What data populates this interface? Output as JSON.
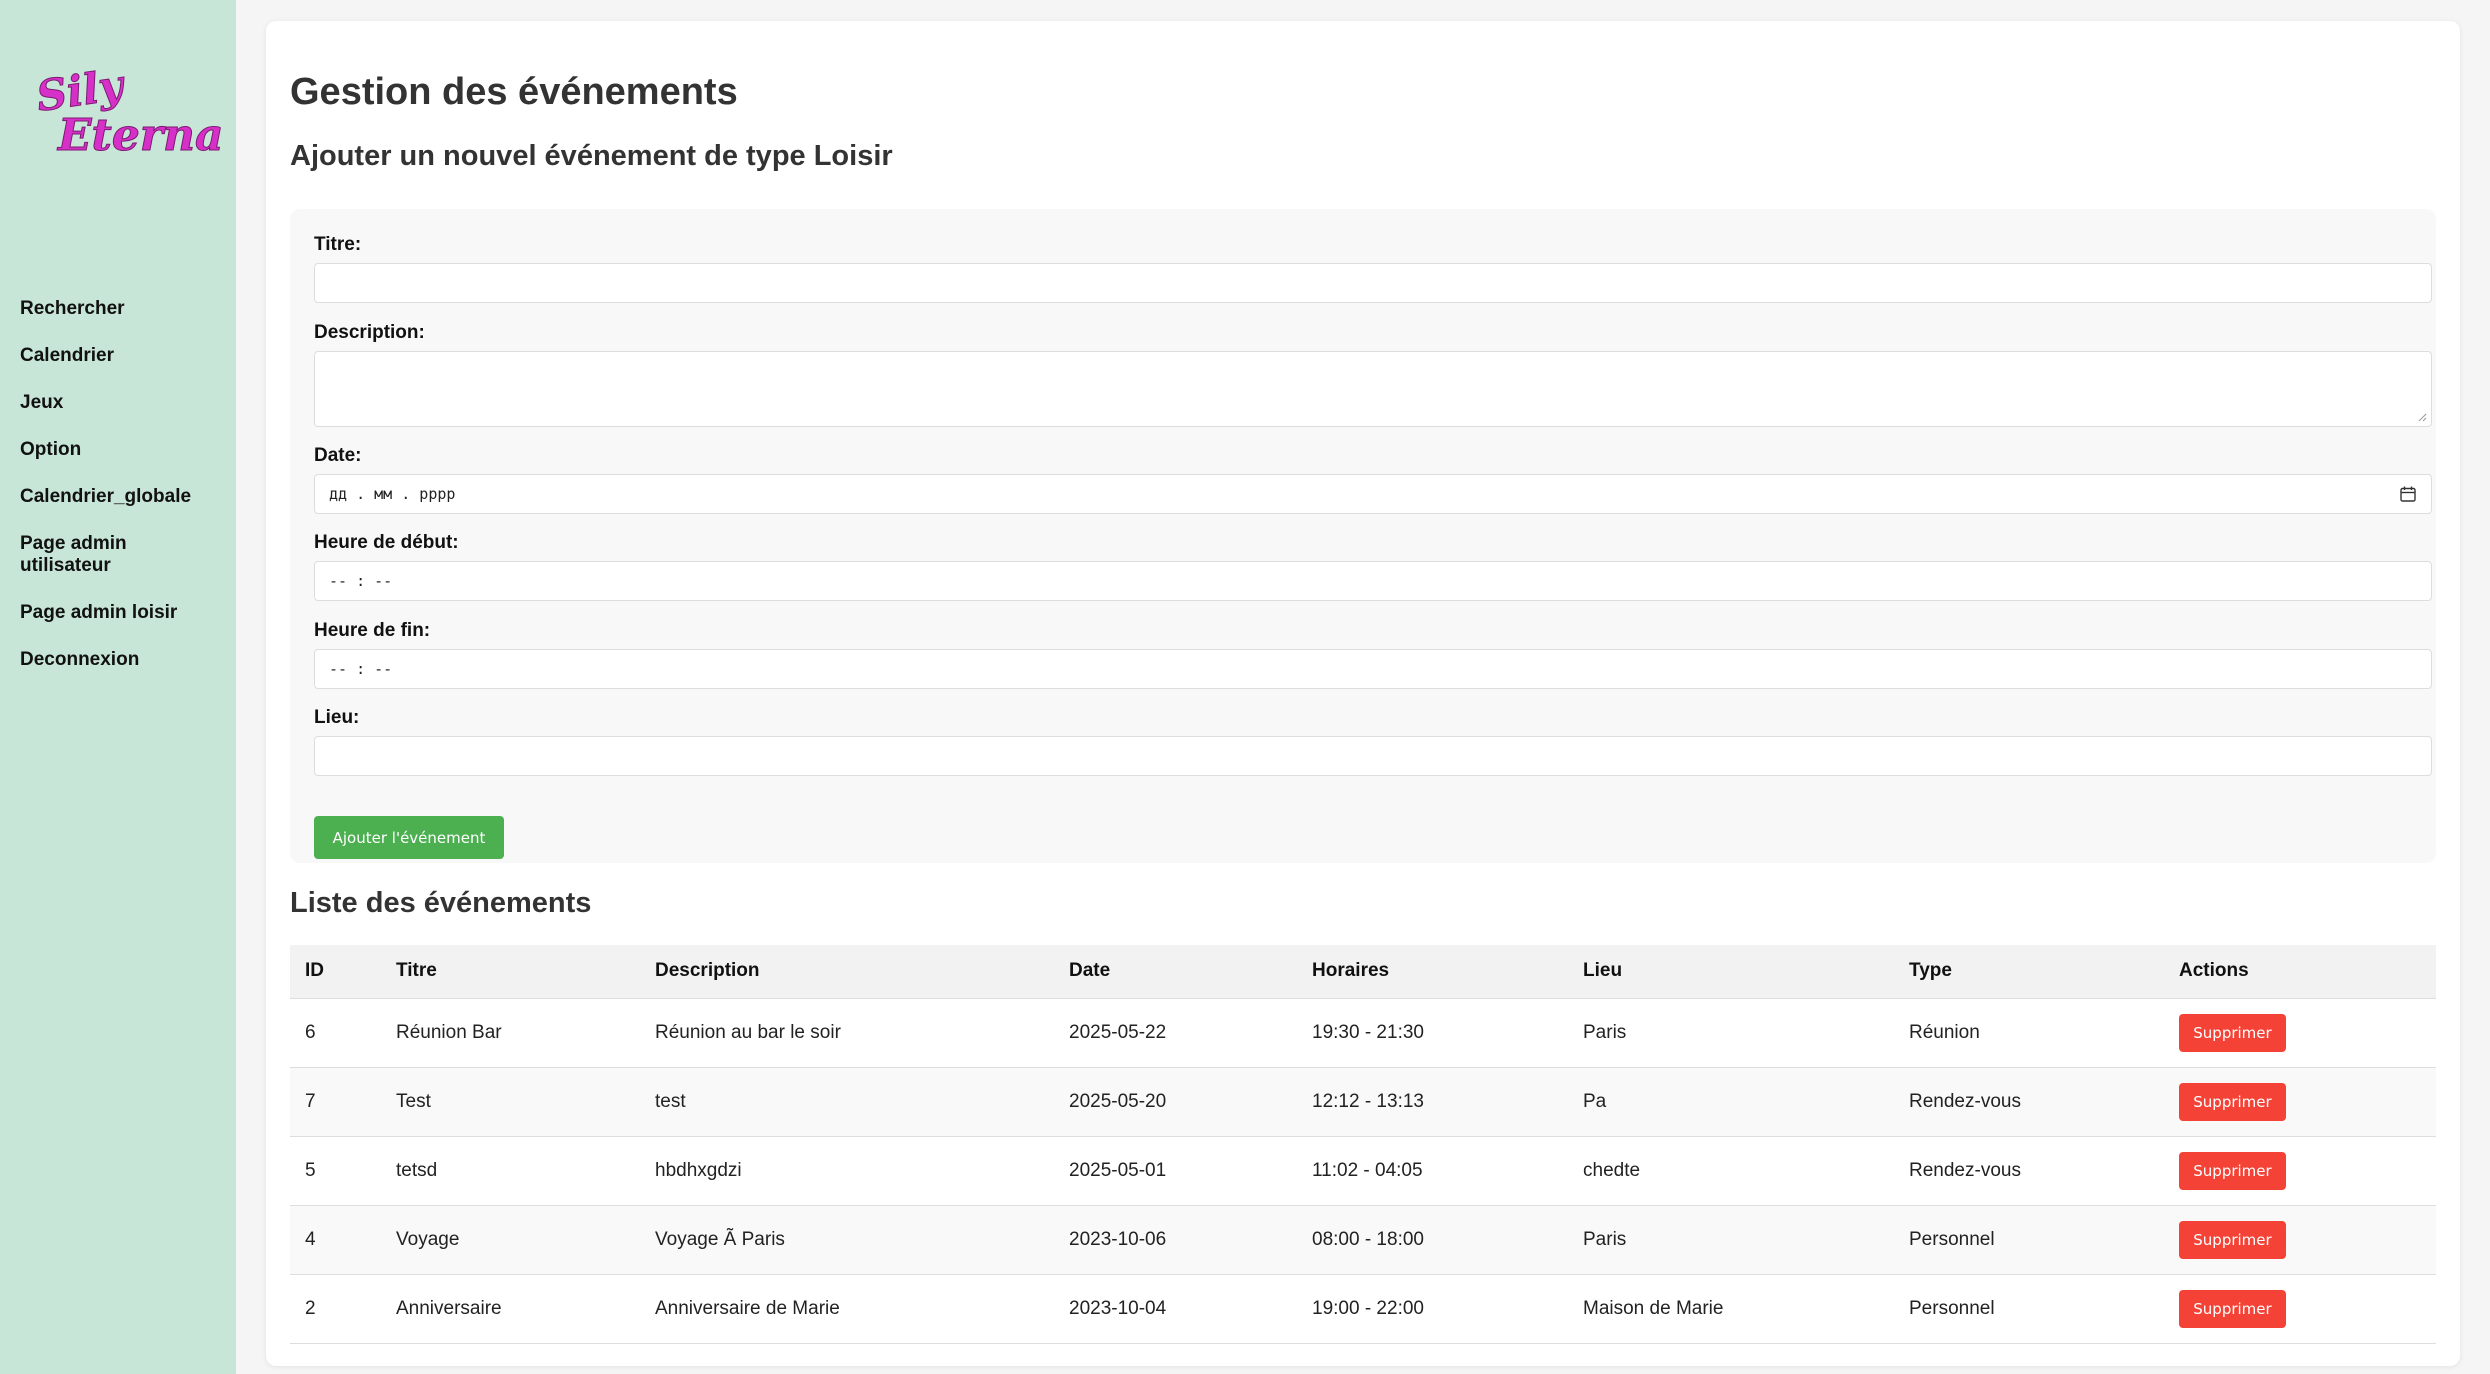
{
  "brand": {
    "logo_line1": "Sily",
    "logo_line2": "Eterna",
    "color": "#d630c8"
  },
  "sidebar": {
    "items": [
      {
        "label": "Rechercher"
      },
      {
        "label": "Calendrier"
      },
      {
        "label": "Jeux"
      },
      {
        "label": "Option"
      },
      {
        "label": "Calendrier_globale"
      },
      {
        "label": "Page admin utilisateur"
      },
      {
        "label": "Page admin loisir"
      },
      {
        "label": "Deconnexion"
      }
    ]
  },
  "page": {
    "title": "Gestion des événements",
    "form_title": "Ajouter un nouvel événement de type Loisir",
    "list_title": "Liste des événements"
  },
  "form": {
    "titre_label": "Titre:",
    "titre_value": "",
    "description_label": "Description:",
    "description_value": "",
    "date_label": "Date:",
    "date_placeholder": "дд . мм . рррр",
    "start_label": "Heure de début:",
    "start_placeholder": "-- : --",
    "end_label": "Heure de fin:",
    "end_placeholder": "-- : --",
    "lieu_label": "Lieu:",
    "lieu_value": "",
    "submit_label": "Ajouter l'événement"
  },
  "table": {
    "headers": [
      "ID",
      "Titre",
      "Description",
      "Date",
      "Horaires",
      "Lieu",
      "Type",
      "Actions"
    ],
    "delete_label": "Supprimer",
    "rows": [
      {
        "id": "6",
        "titre": "Réunion Bar",
        "description": "Réunion au bar le soir",
        "date": "2025-05-22",
        "horaires": "19:30 - 21:30",
        "lieu": "Paris",
        "type": "Réunion"
      },
      {
        "id": "7",
        "titre": "Test",
        "description": "test",
        "date": "2025-05-20",
        "horaires": "12:12 - 13:13",
        "lieu": "Pa",
        "type": "Rendez-vous"
      },
      {
        "id": "5",
        "titre": "tetsd",
        "description": "hbdhxgdzi",
        "date": "2025-05-01",
        "horaires": "11:02 - 04:05",
        "lieu": "chedte",
        "type": "Rendez-vous"
      },
      {
        "id": "4",
        "titre": "Voyage",
        "description": "Voyage Ã  Paris",
        "date": "2023-10-06",
        "horaires": "08:00 - 18:00",
        "lieu": "Paris",
        "type": "Personnel"
      },
      {
        "id": "2",
        "titre": "Anniversaire",
        "description": "Anniversaire de Marie",
        "date": "2023-10-04",
        "horaires": "19:00 - 22:00",
        "lieu": "Maison de Marie",
        "type": "Personnel"
      }
    ]
  },
  "colors": {
    "sidebar_bg": "#c8e6d8",
    "add_button": "#4caf50",
    "delete_button": "#f44336"
  }
}
